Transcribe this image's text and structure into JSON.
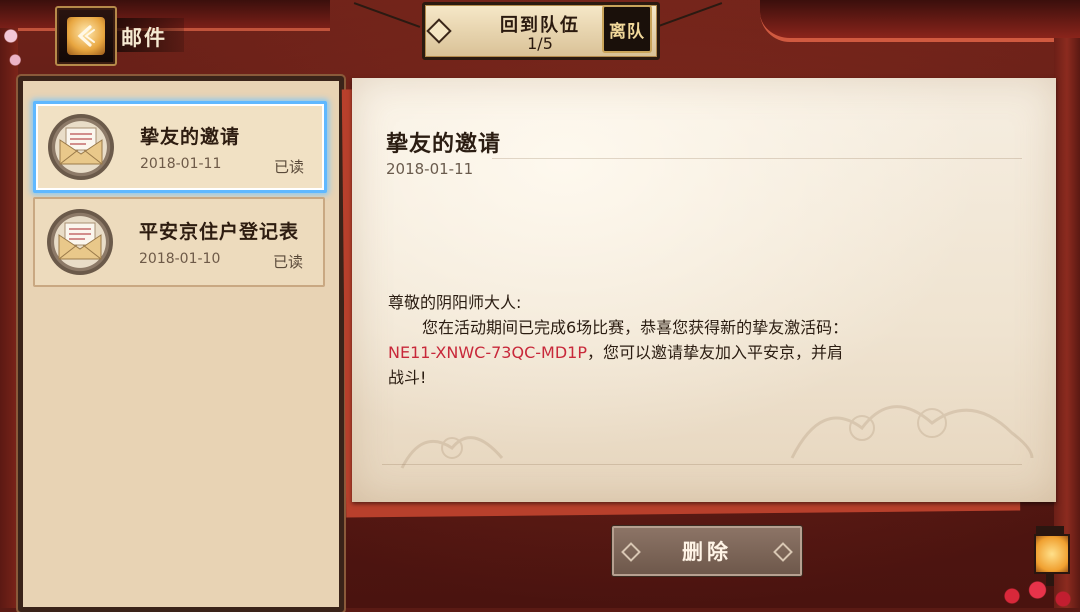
{
  "header": {
    "title": "邮件",
    "back_icon": "back-arrow-icon"
  },
  "team": {
    "label": "回到队伍",
    "count": "1/5",
    "leave_label": "离队"
  },
  "mails": [
    {
      "title": "挚友的邀请",
      "date": "2018-01-11",
      "status": "已读",
      "selected": true,
      "icon": "envelope-icon"
    },
    {
      "title": "平安京住户登记表",
      "date": "2018-01-10",
      "status": "已读",
      "selected": false,
      "icon": "envelope-icon"
    }
  ],
  "letter": {
    "title": "挚友的邀请",
    "date": "2018-01-11",
    "greeting": "尊敬的阴阳师大人:",
    "line1": "您在活动期间已完成6场比赛，恭喜您获得新的挚友激活码：",
    "code": "NE11-XNWC-73QC-MD1P",
    "line2_rest": "，您可以邀请挚友加入平安京，并肩",
    "line3": "战斗!"
  },
  "actions": {
    "delete_label": "删除"
  },
  "colors": {
    "code": "#c8283a",
    "selected_border": "#5fb8ff",
    "background": "#5a1a14"
  }
}
